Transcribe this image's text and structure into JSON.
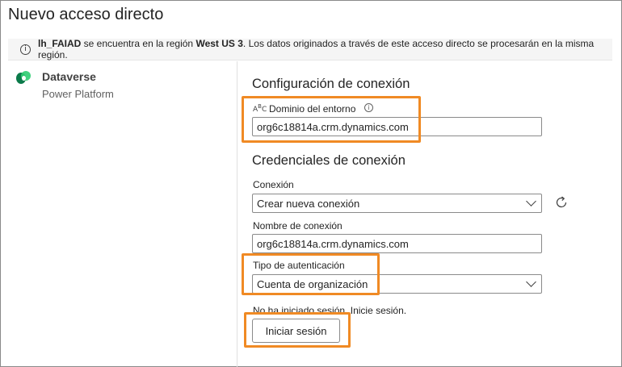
{
  "dialog": {
    "title": "Nuevo acceso directo"
  },
  "info_bar": {
    "icon": "info-icon",
    "lakehouse": "lh_FAIAD",
    "text_1": " se encuentra en la región ",
    "region": "West US 3",
    "text_2": ". Los datos originados a través de este acceso directo se procesarán en la misma región."
  },
  "connector": {
    "name": "Dataverse",
    "platform": "Power Platform",
    "icon": "dataverse-logo"
  },
  "connection_settings": {
    "heading": "Configuración de conexión",
    "domain_label": "Dominio del entorno",
    "domain_value": "org6c18814a.crm.dynamics.com"
  },
  "credentials": {
    "heading": "Credenciales de conexión",
    "connection_label": "Conexión",
    "connection_value": "Crear nueva conexión",
    "connection_name_label": "Nombre de conexión",
    "connection_name_value": "org6c18814a.crm.dynamics.com",
    "auth_type_label": "Tipo de autenticación",
    "auth_type_value": "Cuenta de organización",
    "signin_status": "No ha iniciado sesión. Inicie sesión.",
    "signin_button": "Iniciar sesión"
  },
  "highlight_color": "#f08a24"
}
